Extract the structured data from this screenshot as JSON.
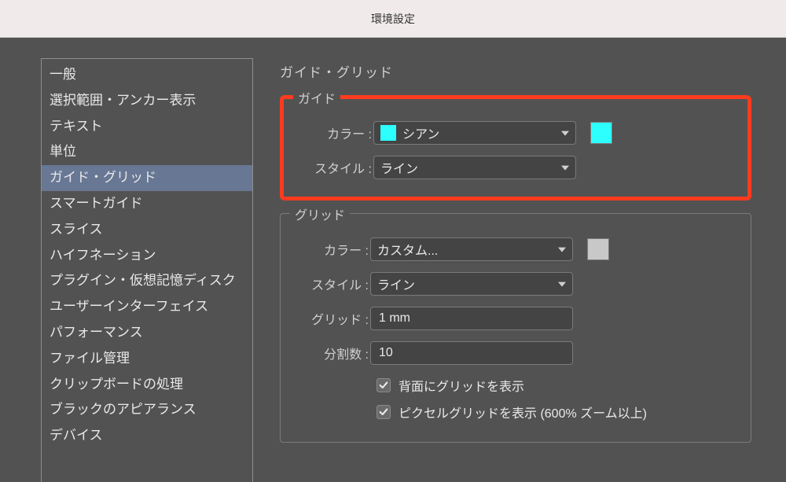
{
  "window": {
    "title": "環境設定"
  },
  "sidebar": {
    "items": [
      {
        "label": "一般"
      },
      {
        "label": "選択範囲・アンカー表示"
      },
      {
        "label": "テキスト"
      },
      {
        "label": "単位"
      },
      {
        "label": "ガイド・グリッド",
        "selected": true
      },
      {
        "label": "スマートガイド"
      },
      {
        "label": "スライス"
      },
      {
        "label": "ハイフネーション"
      },
      {
        "label": "プラグイン・仮想記憶ディスク"
      },
      {
        "label": "ユーザーインターフェイス"
      },
      {
        "label": "パフォーマンス"
      },
      {
        "label": "ファイル管理"
      },
      {
        "label": "クリップボードの処理"
      },
      {
        "label": "ブラックのアピアランス"
      },
      {
        "label": "デバイス"
      }
    ]
  },
  "page": {
    "title": "ガイド・グリッド"
  },
  "guide": {
    "legend": "ガイド",
    "colorLabel": "カラー :",
    "colorValue": "シアン",
    "colorHex": "#2dffff",
    "styleLabel": "スタイル :",
    "styleValue": "ライン"
  },
  "grid": {
    "legend": "グリッド",
    "colorLabel": "カラー :",
    "colorValue": "カスタム...",
    "colorHex": "#c8c8c8",
    "styleLabel": "スタイル :",
    "styleValue": "ライン",
    "gridLabel": "グリッド :",
    "gridValue": "1 mm",
    "divLabel": "分割数 :",
    "divValue": "10",
    "check1": "背面にグリッドを表示",
    "check2": "ピクセルグリッドを表示 (600% ズーム以上)"
  }
}
